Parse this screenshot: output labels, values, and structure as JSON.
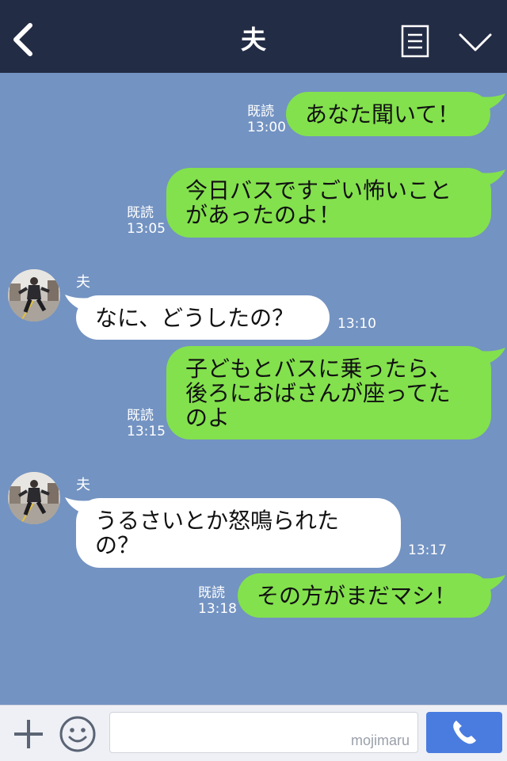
{
  "header": {
    "title": "夫"
  },
  "messages": [
    {
      "side": "out",
      "text": "あなた聞いて！",
      "read": "既読",
      "time": "13:00"
    },
    {
      "side": "out",
      "text": "今日バスですごい怖いことがあったのよ！",
      "read": "既読",
      "time": "13:05"
    },
    {
      "side": "in",
      "sender": "夫",
      "text": "なに、どうしたの？",
      "time": "13:10"
    },
    {
      "side": "out",
      "text": "子どもとバスに乗ったら、後ろにおばさんが座ってたのよ",
      "read": "既読",
      "time": "13:15"
    },
    {
      "side": "in",
      "sender": "夫",
      "text": "うるさいとか怒鳴られたの？",
      "time": "13:17"
    },
    {
      "side": "out",
      "text": "その方がまだマシ！",
      "read": "既読",
      "time": "13:18"
    }
  ],
  "footer": {
    "input_value": "",
    "watermark": "mojimaru"
  },
  "colors": {
    "header_bg": "#232c45",
    "chat_bg": "#7393c2",
    "outgoing_bubble": "#83e14d",
    "incoming_bubble": "#ffffff",
    "call_button": "#4a7ce0"
  }
}
